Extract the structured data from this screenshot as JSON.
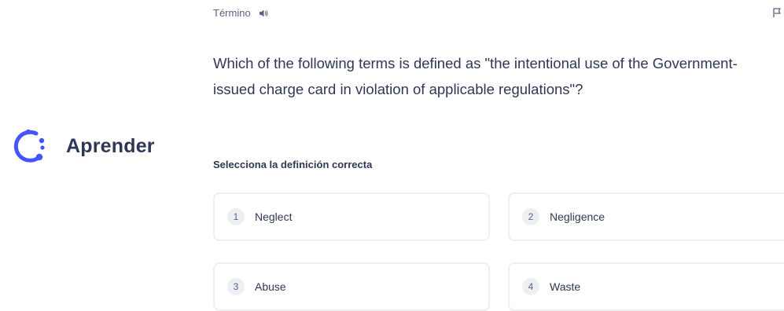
{
  "brand": {
    "label": "Aprender",
    "icon": "learn-mode-icon",
    "accent_color": "#4255ff"
  },
  "card": {
    "term_label": "Término",
    "audio_icon": "speaker-icon",
    "flag_icon": "flag-icon",
    "question": "Which of the following terms is defined as \"the intentional use of the Government-issued charge card in violation of applicable regulations\"?",
    "prompt": "Selecciona la definición correcta"
  },
  "options": [
    {
      "number": "1",
      "label": "Neglect"
    },
    {
      "number": "2",
      "label": "Negligence"
    },
    {
      "number": "3",
      "label": "Abuse"
    },
    {
      "number": "4",
      "label": "Waste"
    }
  ]
}
